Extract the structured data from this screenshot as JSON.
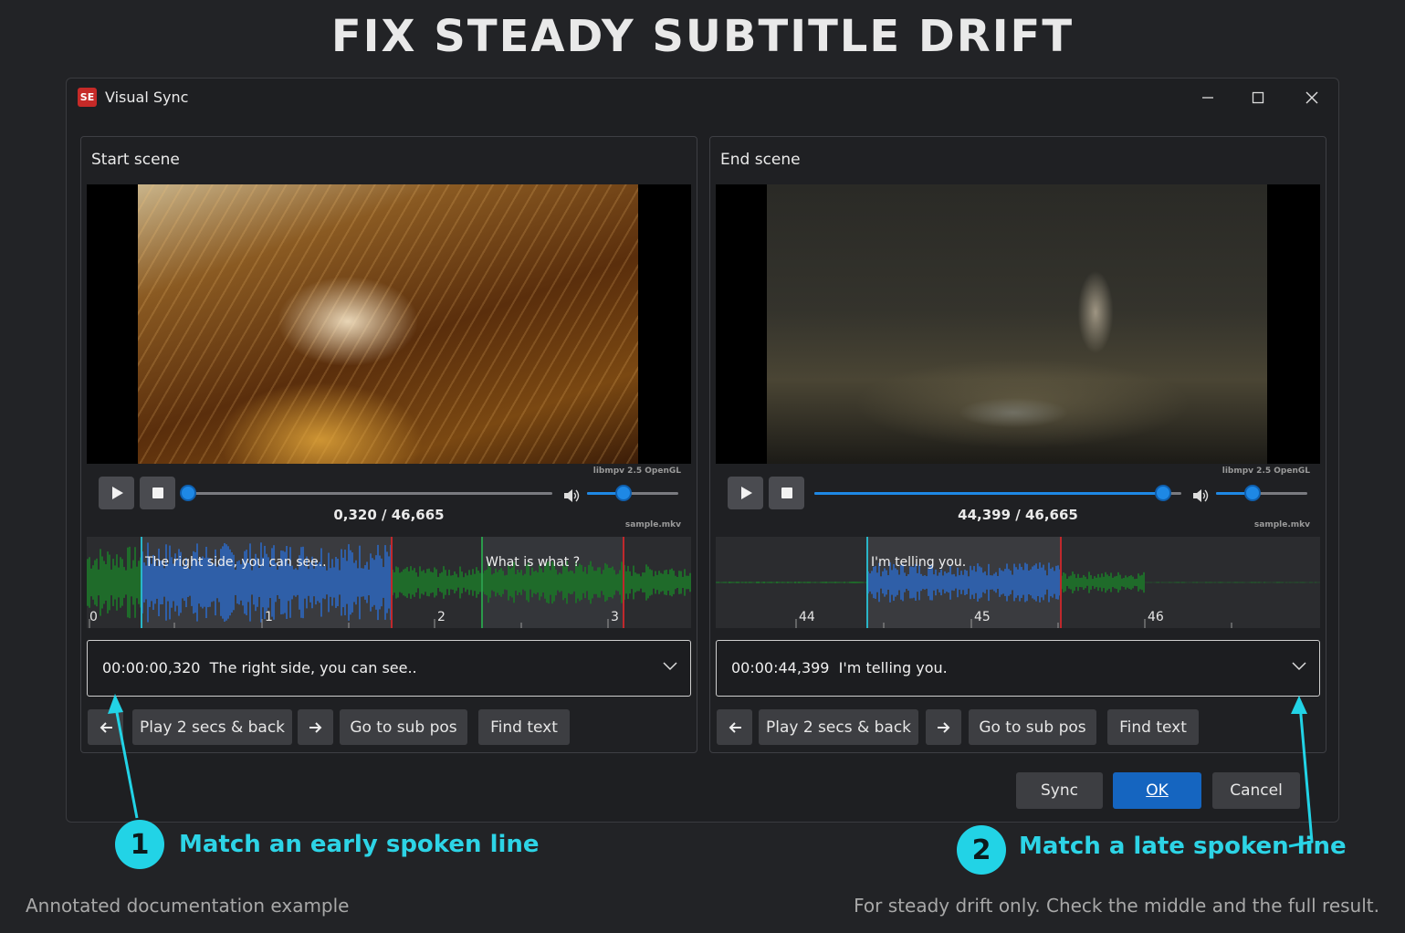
{
  "heading": "FIX STEADY SUBTITLE DRIFT",
  "window": {
    "title": "Visual Sync",
    "logo": "SE",
    "controls": [
      "minimize-icon",
      "maximize-icon",
      "close-icon"
    ]
  },
  "start_panel": {
    "title": "Start scene",
    "time": "0,320 / 46,665",
    "engine": "libmpv 2.5 OpenGL",
    "file": "sample.mkv",
    "progress": 0.007,
    "volume": 0.4,
    "waveform": {
      "subtitles": [
        "The right side, you can see..",
        "What is what ?"
      ],
      "ticks": [
        "0",
        "1",
        "2",
        "3"
      ]
    },
    "selected": "00:00:00,320  The right side, you can see..",
    "buttons": {
      "back": "prev-arrow-icon",
      "play": "Play 2 secs & back",
      "forward": "next-arrow-icon",
      "goto": "Go to sub pos",
      "find": "Find text"
    }
  },
  "end_panel": {
    "title": "End scene",
    "time": "44,399 / 46,665",
    "engine": "libmpv 2.5 OpenGL",
    "file": "sample.mkv",
    "progress": 0.951,
    "volume": 0.4,
    "waveform": {
      "subtitles": [
        "I'm telling you."
      ],
      "ticks": [
        "44",
        "45",
        "46"
      ]
    },
    "selected": "00:00:44,399  I'm telling you.",
    "buttons": {
      "back": "prev-arrow-icon",
      "play": "Play 2 secs & back",
      "forward": "next-arrow-icon",
      "goto": "Go to sub pos",
      "find": "Find text"
    }
  },
  "dialog_buttons": {
    "sync": "Sync",
    "ok": "OK",
    "cancel": "Cancel"
  },
  "annotations": {
    "step1_number": "1",
    "step1_text": "Match an early spoken line",
    "step2_number": "2",
    "step2_text": "Match a late spoken line"
  },
  "footer": {
    "left": "Annotated documentation example",
    "right": "For steady drift only. Check the middle and the full result."
  },
  "colors": {
    "accent": "#1e88e5",
    "annotation": "#22d3e6",
    "wave_green": "#1f6b2a",
    "wave_blue": "#2f5fa8",
    "marker_start": "#29b6c8",
    "marker_end": "#c0282c"
  }
}
